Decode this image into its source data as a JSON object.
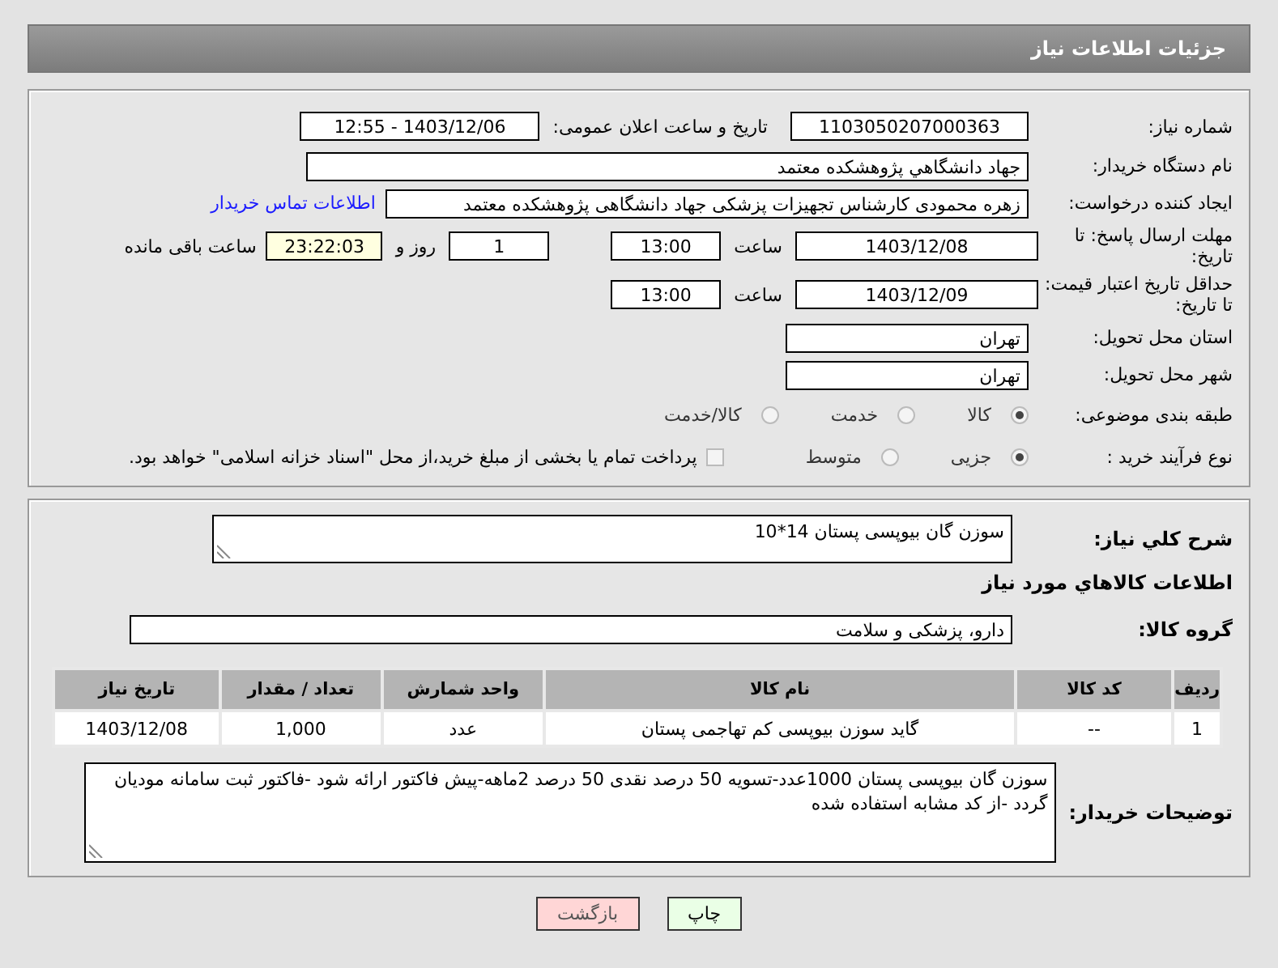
{
  "header": {
    "title": "جزئیات اطلاعات نیاز"
  },
  "need_number": {
    "label": "شماره نیاز:",
    "value": "1103050207000363"
  },
  "announce": {
    "label": "تاریخ و ساعت اعلان عمومی:",
    "value": "1403/12/06 - 12:55"
  },
  "buyer": {
    "label": "نام دستگاه خریدار:",
    "value": "جهاد دانشگاهي پژوهشکده معتمد"
  },
  "requester": {
    "label": "ایجاد کننده درخواست:",
    "value": "زهره محمودی کارشناس تجهیزات پزشکی جهاد دانشگاهی پژوهشکده معتمد",
    "link": "اطلاعات تماس خریدار"
  },
  "reply_deadline": {
    "label": "مهلت ارسال پاسخ: تا تاریخ:",
    "date": "1403/12/08",
    "time_label": "ساعت",
    "time": "13:00",
    "days": "1",
    "days_label": "روز و",
    "remaining": "23:22:03",
    "remaining_label": "ساعت باقی مانده"
  },
  "price_validity": {
    "label": "حداقل تاریخ اعتبار قیمت: تا تاریخ:",
    "date": "1403/12/09",
    "time_label": "ساعت",
    "time": "13:00"
  },
  "province": {
    "label": "استان محل تحویل:",
    "value": "تهران"
  },
  "city": {
    "label": "شهر محل تحویل:",
    "value": "تهران"
  },
  "category": {
    "label": "طبقه بندی موضوعی:",
    "options": [
      {
        "label": "کالا",
        "selected": true
      },
      {
        "label": "خدمت",
        "selected": false
      },
      {
        "label": "کالا/خدمت",
        "selected": false
      }
    ]
  },
  "purchase_process": {
    "label": "نوع فرآیند خرید :",
    "options": [
      {
        "label": "جزیی",
        "selected": true
      },
      {
        "label": "متوسط",
        "selected": false
      }
    ],
    "treasury": {
      "label": "پرداخت تمام یا بخشی از مبلغ خرید،از محل \"اسناد خزانه اسلامی\" خواهد بود.",
      "checked": false
    }
  },
  "description": {
    "label": "شرح کلي نياز:",
    "value": "سوزن گان بیوپسی پستان 14*10"
  },
  "goods_title": "اطلاعات کالاهاي مورد نياز",
  "goods_group": {
    "label": "گروه کالا:",
    "value": "دارو، پزشکی و سلامت"
  },
  "table": {
    "columns": [
      "ردیف",
      "کد کالا",
      "نام کالا",
      "واحد شمارش",
      "تعداد / مقدار",
      "تاریخ نیاز"
    ],
    "rows": [
      [
        "1",
        "--",
        "گاید سوزن بیوپسی کم تهاجمی پستان",
        "عدد",
        "1,000",
        "1403/12/08"
      ]
    ]
  },
  "buyer_notes": {
    "label": "توضیحات خریدار:",
    "value": "سوزن گان بیوپسی پستان 1000عدد-تسویه 50 درصد نقدی 50 درصد 2ماهه-پیش فاکتور ارائه شود -فاکتور ثبت سامانه مودیان گردد -از کد مشابه استفاده شده"
  },
  "buttons": [
    {
      "label": "چاپ",
      "kind": "print"
    },
    {
      "label": "بازگشت",
      "kind": "back"
    }
  ]
}
